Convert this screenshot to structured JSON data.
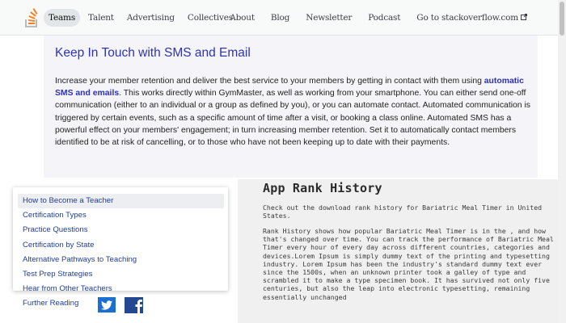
{
  "colors": {
    "accent_blue": "#2d33b5",
    "link_blue": "#1f3f9a",
    "twitter_blue": "#1b6fd0",
    "facebook_blue": "#24488f",
    "logo_orange": "#f48024"
  },
  "header": {
    "logo_icon": "stackoverflow-logo-icon",
    "nav_left": [
      {
        "label": "Teams",
        "active": true
      },
      {
        "label": "Talent"
      },
      {
        "label": "Advertising"
      },
      {
        "label": "Collectives"
      }
    ],
    "nav_right": [
      {
        "label": "About"
      },
      {
        "label": "Blog"
      },
      {
        "label": "Newsletter"
      },
      {
        "label": "Podcast"
      },
      {
        "label": "Go to stackoverflow.com",
        "icon": "external-link-icon"
      }
    ]
  },
  "sms_section": {
    "title": "Keep In Touch with SMS and Email",
    "body_before": "Increase your member retention and deliver the best service to your members by getting in contact with them using ",
    "body_bold": "automatic SMS and emails",
    "body_after": ". This works directly within GymMaster, as well as working from your smartphone. You can either send one-off communication (either to an individual or a group as defined by you), or you can automate contact. Automated communication is triggered by certain events, such as a specific amount of time after a visit, or booking a class online. Automated SMS has a powerful effect on your members' engagement; in turn increasing member retention. Set it to automatically contact members identified to be at risk of cancelling, or to those who have not been keeping up to date with their payments."
  },
  "toc": {
    "items": [
      {
        "label": "How to Become a Teacher",
        "active": true
      },
      {
        "label": "Certification Types"
      },
      {
        "label": "Practice Questions"
      },
      {
        "label": "Certification by State"
      },
      {
        "label": "Alternative Pathways to Teaching"
      },
      {
        "label": "Test Prep Strategies"
      },
      {
        "label": "Hear from Other Teachers"
      }
    ],
    "further_reading": "Further Reading",
    "social_icons": [
      "twitter-icon",
      "facebook-icon"
    ]
  },
  "rank_history": {
    "title": "App Rank History",
    "intro": "Check out the download rank history for Bariatric Meal Timer in United States.",
    "body": "Rank History shows how popular Bariatric Meal Timer is in the , and how that's changed over time. You can track the performance of Bariatric Meal Timer every hour of every day across different countries, categories and devices.Lorem Ipsum is simply dummy text of the printing and typesetting industry. Lorem Ipsum has been the industry's standard dummy text ever since the 1500s, when an unknown printer took a galley of type and scrambled it to make a type specimen book. It has survived not only five centuries, but also the leap into electronic typesetting, remaining essentially unchanged"
  }
}
